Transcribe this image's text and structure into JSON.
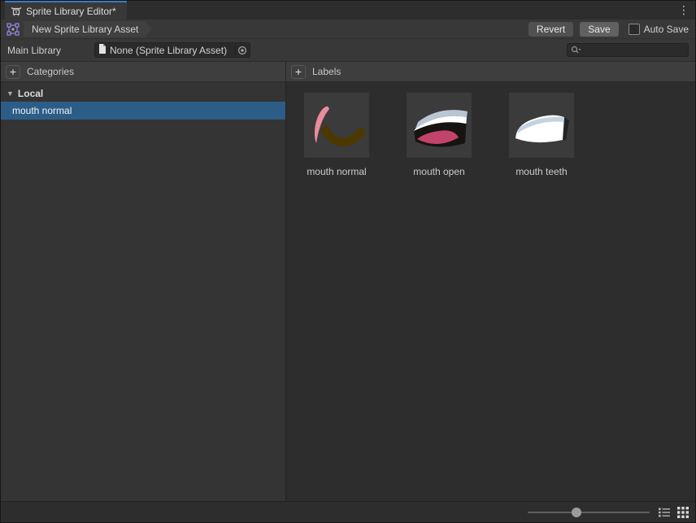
{
  "window": {
    "tab_title": "Sprite Library Editor*",
    "tab_icon": "sprite-library-editor-icon",
    "menu_icon": "kebab-menu-icon",
    "menu_glyph": "⋮"
  },
  "toolbar": {
    "asset_icon": "sprite-library-asset-icon",
    "breadcrumb": "New Sprite Library Asset",
    "revert_label": "Revert",
    "save_label": "Save",
    "auto_save_label": "Auto Save",
    "auto_save_checked": false
  },
  "library_row": {
    "label": "Main Library",
    "object_icon": "text-asset-icon",
    "object_value": "None (Sprite Library Asset)",
    "picker_icon": "object-picker-icon",
    "search_icon": "search-icon",
    "search_placeholder": "",
    "search_value": ""
  },
  "categories": {
    "header": "Categories",
    "add_button": "+",
    "group_label": "Local",
    "foldout_glyph": "▼",
    "items": [
      {
        "name": "mouth normal",
        "selected": true
      }
    ]
  },
  "labels": {
    "header": "Labels",
    "add_button": "+",
    "items": [
      {
        "name": "mouth normal"
      },
      {
        "name": "mouth open"
      },
      {
        "name": "mouth teeth"
      }
    ]
  },
  "bottom_bar": {
    "slider_position": 0.4,
    "list_view_icon": "list-view-icon",
    "grid_view_icon": "grid-view-icon",
    "active_view": "grid"
  },
  "colors": {
    "selection": "#2c5d87",
    "tab_accent": "#3a79bb",
    "asset_purple": "#9b87e8",
    "save_button": "#616161",
    "revert_button": "#515151"
  }
}
